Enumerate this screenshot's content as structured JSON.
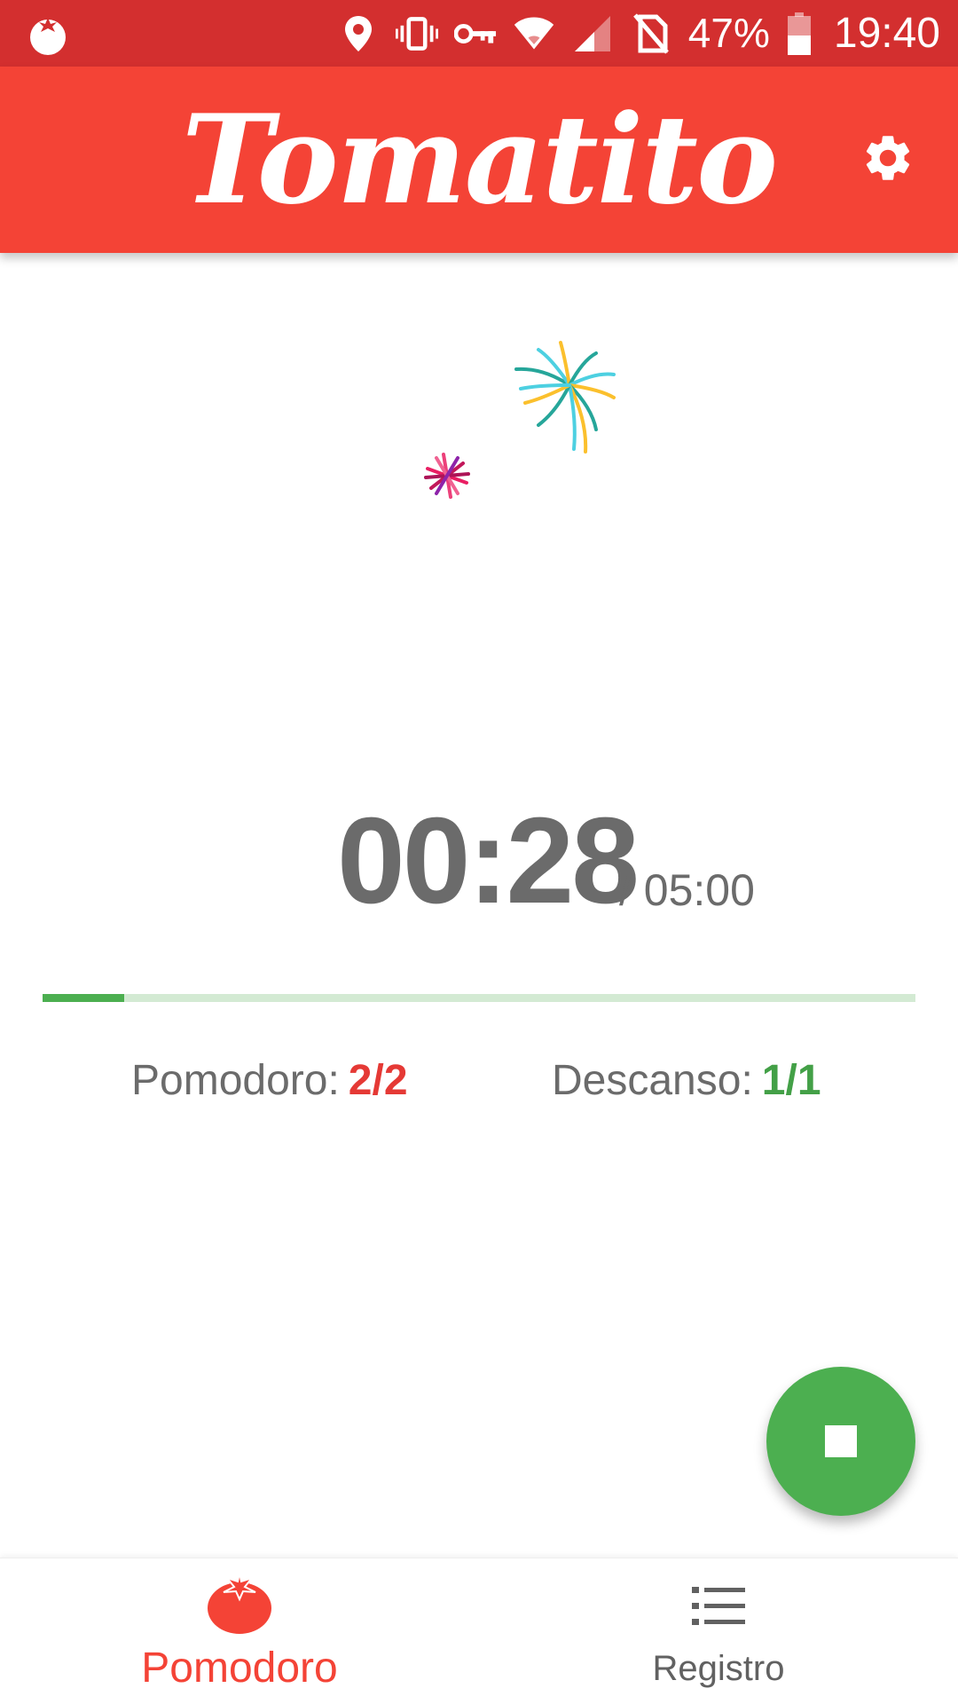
{
  "status_bar": {
    "battery": "47%",
    "time": "19:40",
    "icons": [
      "tomato-app-icon",
      "location-icon",
      "vibrate-icon",
      "vpn-key-icon",
      "wifi-icon",
      "signal-icon",
      "no-sim-icon",
      "battery-icon"
    ]
  },
  "app_bar": {
    "title": "Tomatito",
    "settings_icon": "gear-icon"
  },
  "timer": {
    "elapsed": "00:28",
    "total": "/ 05:00",
    "progress_fraction": 0.093
  },
  "counters": {
    "pomodoro_label": "Pomodoro:",
    "pomodoro_value": "2/2",
    "descanso_label": "Descanso:",
    "descanso_value": "1/1"
  },
  "fab": {
    "icon": "stop-icon"
  },
  "bottom_nav": {
    "items": [
      {
        "label": "Pomodoro",
        "icon": "tomato-icon",
        "active": true
      },
      {
        "label": "Registro",
        "icon": "list-icon",
        "active": false
      }
    ]
  },
  "colors": {
    "status_bar": "#d32f2f",
    "app_bar": "#f44336",
    "accent_green": "#4caf50",
    "accent_red": "#e53935",
    "text_gray": "#6b6b6b"
  }
}
